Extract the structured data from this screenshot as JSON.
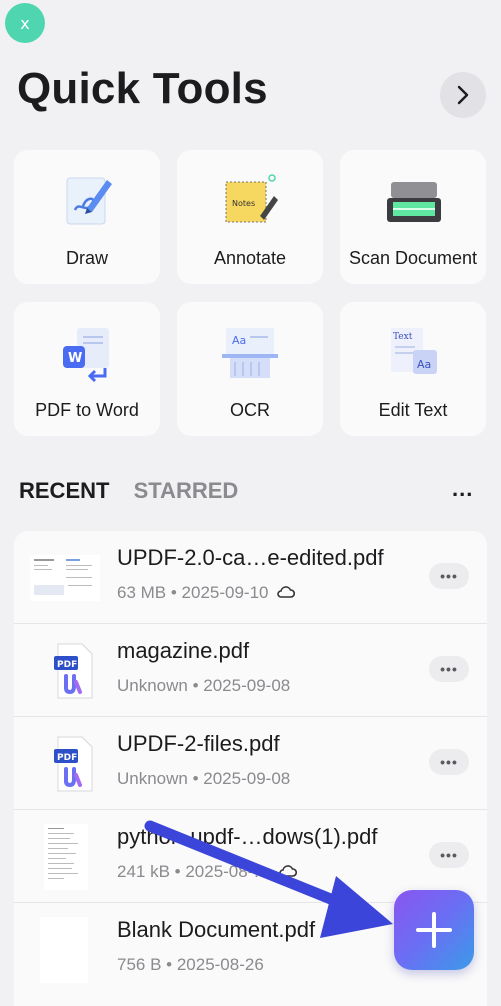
{
  "close_button": {
    "label": "x"
  },
  "title": "Quick Tools",
  "tools": [
    {
      "label": "Draw",
      "icon": "draw-icon"
    },
    {
      "label": "Annotate",
      "icon": "annotate-icon"
    },
    {
      "label": "Scan Document",
      "icon": "scanner-icon"
    },
    {
      "label": "PDF to Word",
      "icon": "pdf-to-word-icon"
    },
    {
      "label": "OCR",
      "icon": "ocr-icon"
    },
    {
      "label": "Edit Text",
      "icon": "edit-text-icon"
    }
  ],
  "tabs": {
    "recent": "RECENT",
    "starred": "STARRED",
    "more": "..."
  },
  "files": [
    {
      "name": "UPDF-2.0-ca…e-edited.pdf",
      "meta": "63 MB • 2025-09-10",
      "cloud": true,
      "more": "•••"
    },
    {
      "name": "magazine.pdf",
      "meta": "Unknown • 2025-09-08",
      "cloud": false,
      "more": "•••"
    },
    {
      "name": "UPDF-2-files.pdf",
      "meta": "Unknown • 2025-09-08",
      "cloud": false,
      "more": "•••"
    },
    {
      "name": "python-updf-…dows(1).pdf",
      "meta": "241 kB • 2025-08-…",
      "cloud": true,
      "more": "•••"
    },
    {
      "name": "Blank Document.pdf",
      "meta": "756 B • 2025-08-26",
      "cloud": false,
      "more": ""
    }
  ],
  "fab": {
    "icon": "plus-icon"
  },
  "colors": {
    "accent_green": "#4fd6b0",
    "fab_start": "#8a55f0",
    "fab_end": "#3a9be8",
    "arrow": "#3b45d9"
  }
}
